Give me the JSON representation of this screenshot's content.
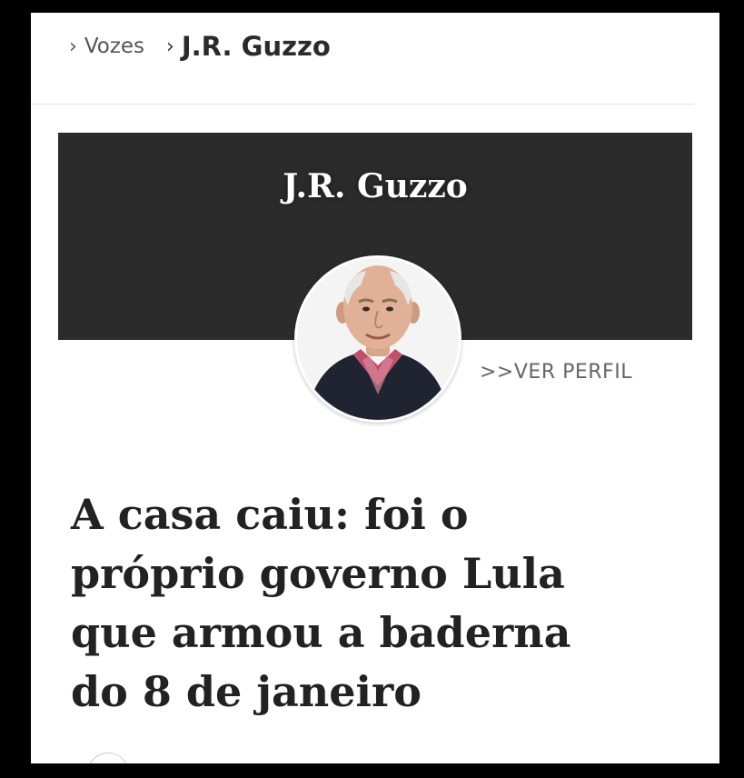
{
  "breadcrumb": {
    "items": [
      {
        "label": "Vozes"
      },
      {
        "label": "J.R. Guzzo"
      }
    ]
  },
  "banner": {
    "title": "J.R. Guzzo",
    "profile_link": ">>VER PERFIL"
  },
  "article": {
    "headline": "A casa caiu: foi o\npróprio governo Lula\nque armou a baderna\ndo 8 de janeiro"
  },
  "colors": {
    "banner_background": "#2b2b2b",
    "page_background": "#ffffff",
    "outer_background": "#000000",
    "headline_text": "#222222"
  },
  "icons": [
    "chevron-right-icon",
    "chevron-right-icon"
  ]
}
